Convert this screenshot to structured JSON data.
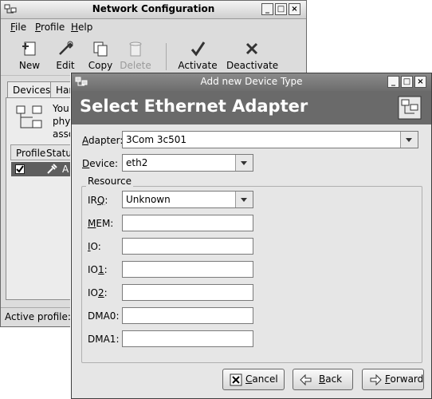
{
  "back_window": {
    "title": "Network Configuration",
    "menu": [
      "File",
      "Profile",
      "Help"
    ],
    "toolbar": [
      {
        "label": "New",
        "icon": "new-icon",
        "enabled": true
      },
      {
        "label": "Edit",
        "icon": "edit-icon",
        "enabled": true
      },
      {
        "label": "Copy",
        "icon": "copy-icon",
        "enabled": true
      },
      {
        "label": "Delete",
        "icon": "trash-icon",
        "enabled": false
      },
      {
        "label": "Activate",
        "icon": "checkmark-icon",
        "enabled": true
      },
      {
        "label": "Deactivate",
        "icon": "x-icon",
        "enabled": true
      }
    ],
    "tabs": [
      "Devices",
      "Har"
    ],
    "description_lines": [
      "You",
      "phys",
      "asso"
    ],
    "list_headers": [
      "Profile",
      "Status"
    ],
    "row": {
      "checked": true,
      "text": "A"
    },
    "status": "Active profile: C"
  },
  "dialog": {
    "title": "Add new Device Type",
    "heading": "Select Ethernet Adapter",
    "adapter_label": "Adapter:",
    "adapter_value": "3Com 3c501",
    "device_label": "Device:",
    "device_value": "eth2",
    "resource_title": "Resource",
    "irq_label": "IRQ:",
    "irq_value": "Unknown",
    "mem_label": "MEM:",
    "io_label": "IO:",
    "io1_label": "IO1:",
    "io2_label": "IO2:",
    "dma0_label": "DMA0:",
    "dma1_label": "DMA1:",
    "buttons": {
      "cancel": "Cancel",
      "back": "Back",
      "forward": "Forward"
    }
  }
}
